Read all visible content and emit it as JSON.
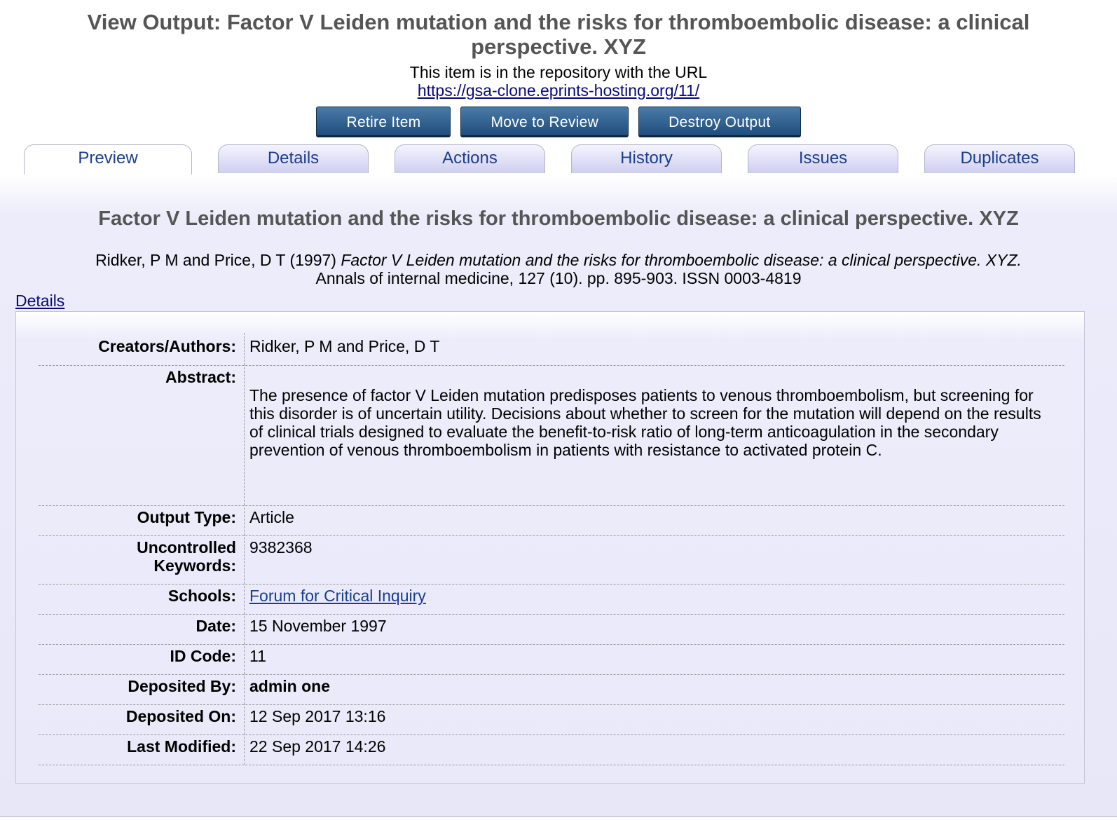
{
  "header": {
    "title": "View Output: Factor V Leiden mutation and the risks for thromboembolic disease: a clinical perspective. XYZ",
    "repo_note": "This item is in the repository with the URL",
    "repo_url": "https://gsa-clone.eprints-hosting.org/11/"
  },
  "actions": {
    "retire": "Retire Item",
    "move_review": "Move to Review",
    "destroy": "Destroy Output"
  },
  "tabs": [
    {
      "label": "Preview",
      "active": true
    },
    {
      "label": "Details",
      "active": false
    },
    {
      "label": "Actions",
      "active": false
    },
    {
      "label": "History",
      "active": false
    },
    {
      "label": "Issues",
      "active": false
    },
    {
      "label": "Duplicates",
      "active": false
    }
  ],
  "preview": {
    "title": "Factor V Leiden mutation and the risks for thromboembolic disease: a clinical perspective. XYZ",
    "citation_authors": "Ridker, P M and Price, D T (1997)",
    "citation_title": "Factor V Leiden mutation and the risks for thromboembolic disease: a clinical perspective. XYZ.",
    "citation_journal": "Annals of internal medicine, 127 (10). pp. 895-903. ISSN 0003-4819",
    "details_link": "Details"
  },
  "details": {
    "creators_label": "Creators/Authors:",
    "creators_value": "Ridker, P M and Price, D T",
    "abstract_label": "Abstract:",
    "abstract_value": "The presence of factor V Leiden mutation predisposes patients to venous thromboembolism, but screening for this disorder is of uncertain utility. Decisions about whether to screen for the mutation will depend on the results of clinical trials designed to evaluate the benefit-to-risk ratio of long-term anticoagulation in the secondary prevention of venous thromboembolism in patients with resistance to activated protein C.",
    "output_type_label": "Output Type:",
    "output_type_value": "Article",
    "keywords_label_1": "Uncontrolled",
    "keywords_label_2": "Keywords:",
    "keywords_value": "9382368",
    "schools_label": "Schools:",
    "schools_value": "Forum for Critical Inquiry",
    "date_label": "Date:",
    "date_value": "15 November 1997",
    "id_label": "ID Code:",
    "id_value": "11",
    "deposited_by_label": "Deposited By:",
    "deposited_by_value": "admin one",
    "deposited_on_label": "Deposited On:",
    "deposited_on_value": "12 Sep 2017 13:16",
    "modified_label": "Last Modified:",
    "modified_value": "22 Sep 2017 14:26"
  },
  "colors": {
    "button": "#1f4e7c",
    "tab_text": "#1a3e8e",
    "link": "#0a0a7a",
    "title_gray": "#555555"
  }
}
